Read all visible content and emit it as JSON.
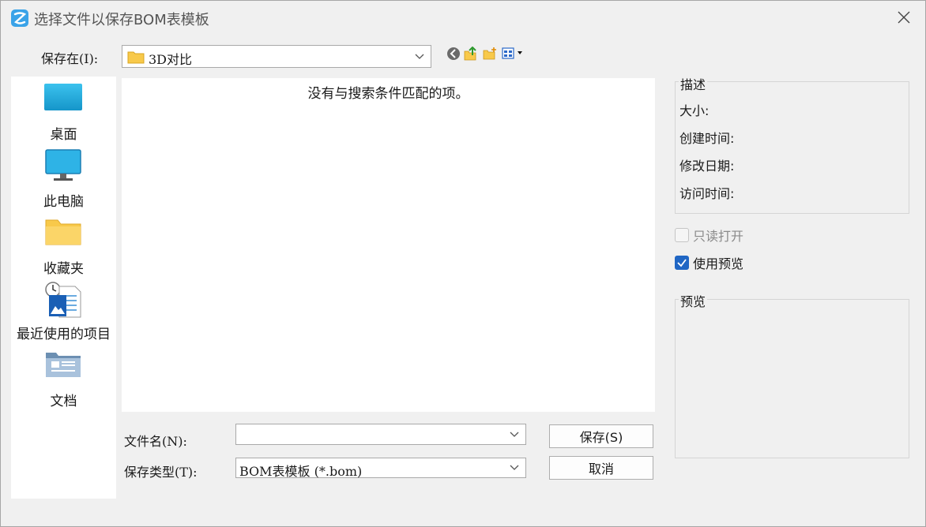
{
  "window": {
    "title": "选择文件以保存BOM表模板"
  },
  "location": {
    "label": "保存在(I):",
    "folder": "3D对比"
  },
  "places": [
    {
      "label": "桌面",
      "icon": "desktop-icon"
    },
    {
      "label": "此电脑",
      "icon": "computer-icon"
    },
    {
      "label": "收藏夹",
      "icon": "folder-icon"
    },
    {
      "label": "最近使用的项目",
      "icon": "recent-icon"
    },
    {
      "label": "文档",
      "icon": "documents-icon"
    }
  ],
  "filelist": {
    "empty_message": "没有与搜索条件匹配的项。"
  },
  "filename": {
    "label": "文件名(N):",
    "value": ""
  },
  "filetype": {
    "label": "保存类型(T):",
    "value": "BOM表模板 (*.bom)"
  },
  "buttons": {
    "save": "保存(S)",
    "cancel": "取消"
  },
  "description": {
    "title": "描述",
    "size_label": "大小:",
    "created_label": "创建时间:",
    "modified_label": "修改日期:",
    "accessed_label": "访问时间:"
  },
  "options": {
    "readonly": {
      "label": "只读打开",
      "checked": false
    },
    "preview": {
      "label": "使用预览",
      "checked": true
    }
  },
  "preview": {
    "title": "预览"
  },
  "colors": {
    "accent": "#1f66c4",
    "folder": "#f8c94a"
  }
}
